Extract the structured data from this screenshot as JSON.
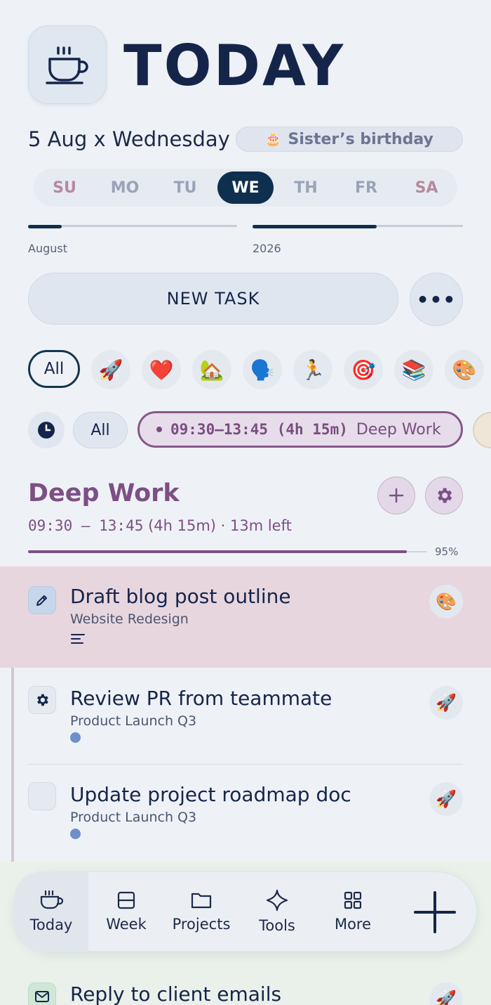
{
  "header": {
    "title": "TODAY",
    "app_icon": "coffee-cup-icon",
    "date_line": "5 Aug x Wednesday",
    "event": {
      "icon": "🎂",
      "label": "Sister’s birthday"
    }
  },
  "week": {
    "days": [
      "SU",
      "MO",
      "TU",
      "WE",
      "TH",
      "FR",
      "SA"
    ],
    "selected": "WE"
  },
  "progress": {
    "month_label": "August",
    "month_fraction": 0.16,
    "year_label": "2026",
    "year_fraction": 0.59
  },
  "actions": {
    "new_task_label": "NEW TASK",
    "more_label": "•••"
  },
  "categories": {
    "all_label": "All",
    "items": [
      {
        "name": "rocket",
        "emoji": "🚀"
      },
      {
        "name": "heart",
        "emoji": "❤️"
      },
      {
        "name": "home",
        "emoji": "🏡"
      },
      {
        "name": "speaking",
        "emoji": "🗣️"
      },
      {
        "name": "running",
        "emoji": "🏃"
      },
      {
        "name": "target",
        "emoji": "🎯"
      },
      {
        "name": "books",
        "emoji": "📚"
      },
      {
        "name": "palette",
        "emoji": "🎨"
      }
    ]
  },
  "time_filter": {
    "all_label": "All",
    "chips": [
      {
        "time": "09:30–13:45 (4h 15m)",
        "label": "Deep Work"
      }
    ]
  },
  "block": {
    "title": "Deep Work",
    "time": "09:30 — 13:45",
    "details": "(4h 15m) · 13m left",
    "progress_percent": 95,
    "progress_label": "95%"
  },
  "tasks": [
    {
      "title": "Draft blog post outline",
      "project": "Website Redesign",
      "icon": "pencil-icon",
      "emoji": "🎨",
      "extra": "notes-icon",
      "highlight": true
    },
    {
      "title": "Review PR from teammate",
      "project": "Product Launch Q3",
      "icon": "gear-icon",
      "emoji": "🚀",
      "extra": "dot"
    },
    {
      "title": "Update project roadmap doc",
      "project": "Product Launch Q3",
      "icon": "",
      "emoji": "🚀",
      "extra": "dot"
    },
    {
      "title": "Reply to client emails",
      "project": "",
      "icon": "mail-icon",
      "emoji": "🚀"
    }
  ],
  "nav": {
    "items": [
      {
        "label": "Today",
        "icon": "coffee-cup-icon"
      },
      {
        "label": "Week",
        "icon": "week-icon"
      },
      {
        "label": "Projects",
        "icon": "folder-icon"
      },
      {
        "label": "Tools",
        "icon": "sparkle-icon"
      },
      {
        "label": "More",
        "icon": "grid-icon"
      }
    ],
    "add_icon": "plus-icon",
    "active": "Today"
  },
  "colors": {
    "accent": "#0f2f4f",
    "block_purple": "#7c4f85",
    "highlight_row": "#e8d6df",
    "background": "#eef2f6"
  }
}
